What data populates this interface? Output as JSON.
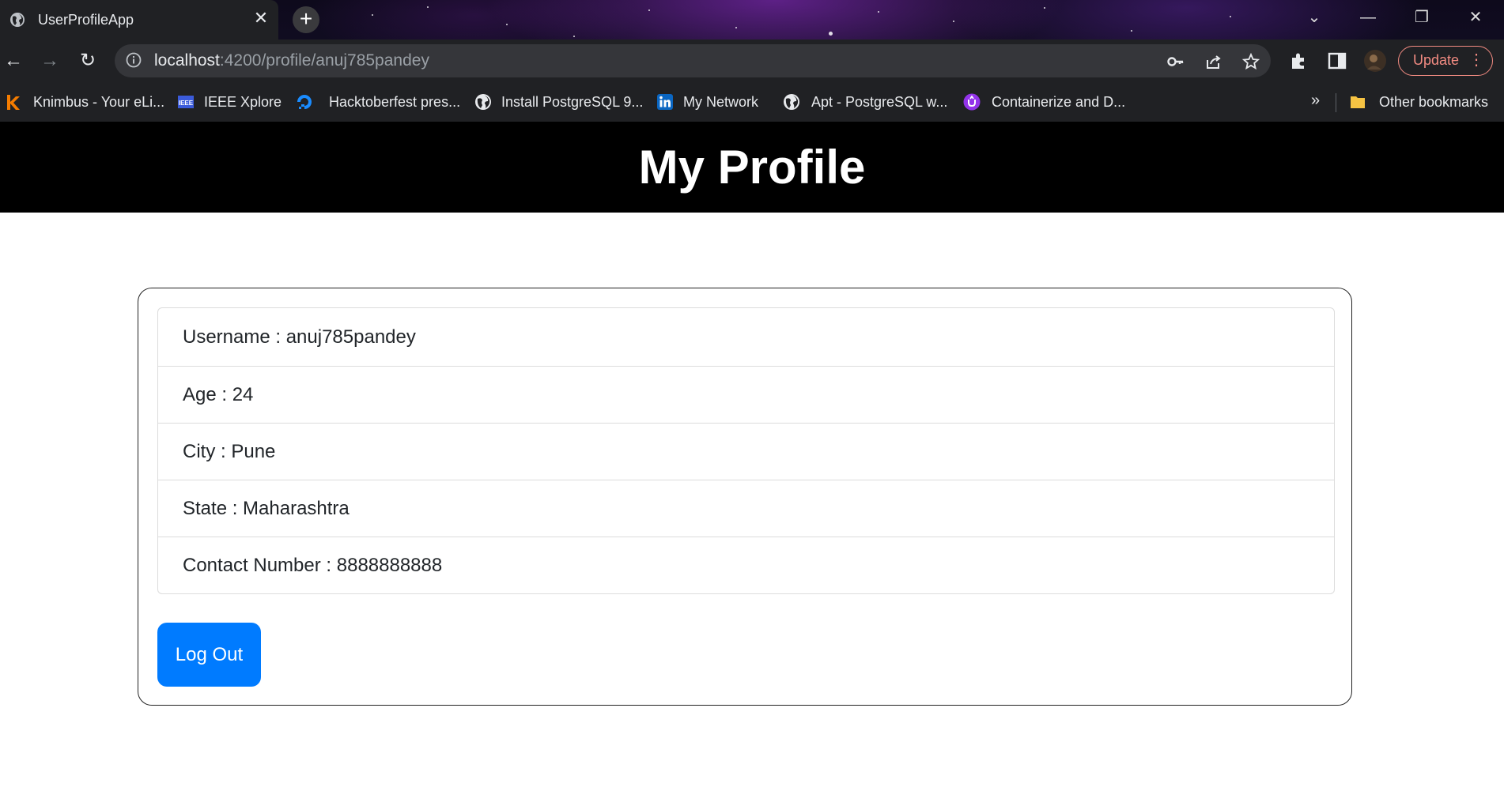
{
  "browser": {
    "tab": {
      "title": "UserProfileApp",
      "close_glyph": "✕",
      "icon": "globe-icon"
    },
    "new_tab_glyph": "+",
    "window_controls": {
      "tab_search": "⌄",
      "minimize": "—",
      "restore": "❐",
      "close": "✕"
    },
    "toolbar": {
      "back": "←",
      "forward": "→",
      "reload": "↻",
      "url_host": "localhost",
      "url_path": ":4200/profile/anuj785pandey",
      "update_label": "Update",
      "menu_glyph": "⋮"
    },
    "bookmarks": [
      {
        "label": "Knimbus - Your eLi...",
        "icon": "knimbus-icon",
        "color": "#f57c00"
      },
      {
        "label": "IEEE Xplore",
        "icon": "ieee-icon",
        "color": "#3b5bdb"
      },
      {
        "label": "Hacktoberfest pres...",
        "icon": "digitalocean-icon",
        "color": "#1a8cff"
      },
      {
        "label": "Install PostgreSQL 9...",
        "icon": "globe-icon",
        "color": "#e8eaed"
      },
      {
        "label": "My Network",
        "icon": "linkedin-icon",
        "color": "#0a66c2"
      },
      {
        "label": "Apt - PostgreSQL w...",
        "icon": "globe-icon",
        "color": "#e8eaed"
      },
      {
        "label": "Containerize and D...",
        "icon": "upgrad-icon",
        "color": "#9333ea"
      }
    ],
    "bookmarks_more": "»",
    "other_bookmarks": "Other bookmarks"
  },
  "page": {
    "header_title": "My Profile",
    "profile_items": [
      "Username : anuj785pandey",
      "Age : 24",
      "City : Pune",
      "State : Maharashtra",
      "Contact Number : 8888888888"
    ],
    "logout_label": "Log Out"
  },
  "colors": {
    "header_bg": "#000000",
    "button_primary": "#007bff",
    "update_accent": "#f28b82"
  }
}
